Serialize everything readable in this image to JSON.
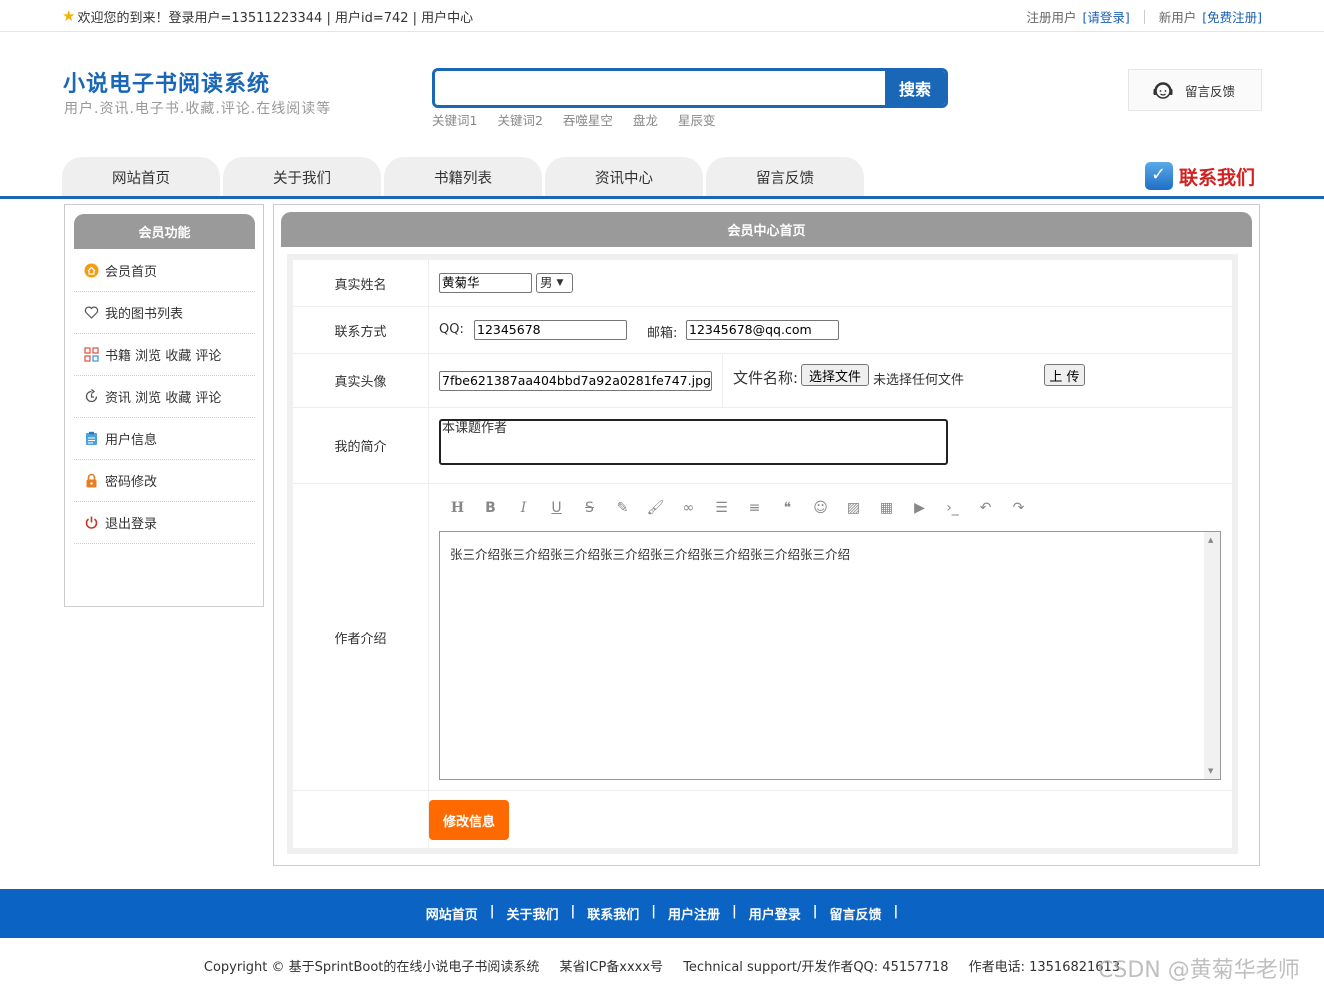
{
  "topbar": {
    "welcome": "欢迎您的到来！登录用户=13511223344 | 用户id=742 | 用户中心",
    "registered_user": "注册用户",
    "login_link": "[请登录]",
    "new_user": "新用户",
    "register_link": "[免费注册]"
  },
  "header": {
    "title": "小说电子书阅读系统",
    "subtitle": "用户.资讯.电子书.收藏.评论.在线阅读等",
    "search_placeholder": "",
    "search_button": "搜索",
    "keywords": [
      "关键词1",
      "关键词2",
      "吞噬星空",
      "盘龙",
      "星辰变"
    ],
    "feedback": "留言反馈"
  },
  "nav": {
    "tabs": [
      "网站首页",
      "关于我们",
      "书籍列表",
      "资讯中心",
      "留言反馈"
    ],
    "contact": "联系我们"
  },
  "sidebar": {
    "title": "会员功能",
    "items": [
      {
        "label": "会员首页",
        "icon": "home-icon"
      },
      {
        "label": "我的图书列表",
        "icon": "heart-icon"
      },
      {
        "label": "书籍 浏览 收藏 评论",
        "icon": "grid-icon"
      },
      {
        "label": "资讯 浏览 收藏 评论",
        "icon": "refresh-icon"
      },
      {
        "label": "用户信息",
        "icon": "clipboard-icon"
      },
      {
        "label": "密码修改",
        "icon": "lock-icon"
      },
      {
        "label": "退出登录",
        "icon": "power-icon"
      }
    ]
  },
  "main": {
    "title": "会员中心首页",
    "form": {
      "name_label": "真实姓名",
      "name_value": "黄菊华",
      "gender_value": "男",
      "contact_label": "联系方式",
      "qq_label": "QQ:",
      "qq_value": "12345678",
      "email_label": "邮箱:",
      "email_value": "12345678@qq.com",
      "avatar_label": "真实头像",
      "avatar_value": "7fbe621387aa404bbd7a92a0281fe747.jpg",
      "file_name_label": "文件名称:",
      "choose_file": "选择文件",
      "no_file": "未选择任何文件",
      "upload": "上 传",
      "intro_label": "我的简介",
      "intro_value": "本课题作者",
      "author_intro_label": "作者介绍",
      "author_intro_value": "张三介绍张三介绍张三介绍张三介绍张三介绍张三介绍张三介绍张三介绍",
      "submit": "修改信息"
    }
  },
  "footer": {
    "links": [
      "网站首页",
      "关于我们",
      "联系我们",
      "用户注册",
      "用户登录",
      "留言反馈"
    ],
    "copyright": "Copyright © 基于SprintBoot的在线小说电子书阅读系统",
    "icp": "某省ICP备xxxx号",
    "support": "Technical support/开发作者QQ:  45157718",
    "phone": "作者电话:  13516821613",
    "watermark": "CSDN @黄菊华老师"
  }
}
